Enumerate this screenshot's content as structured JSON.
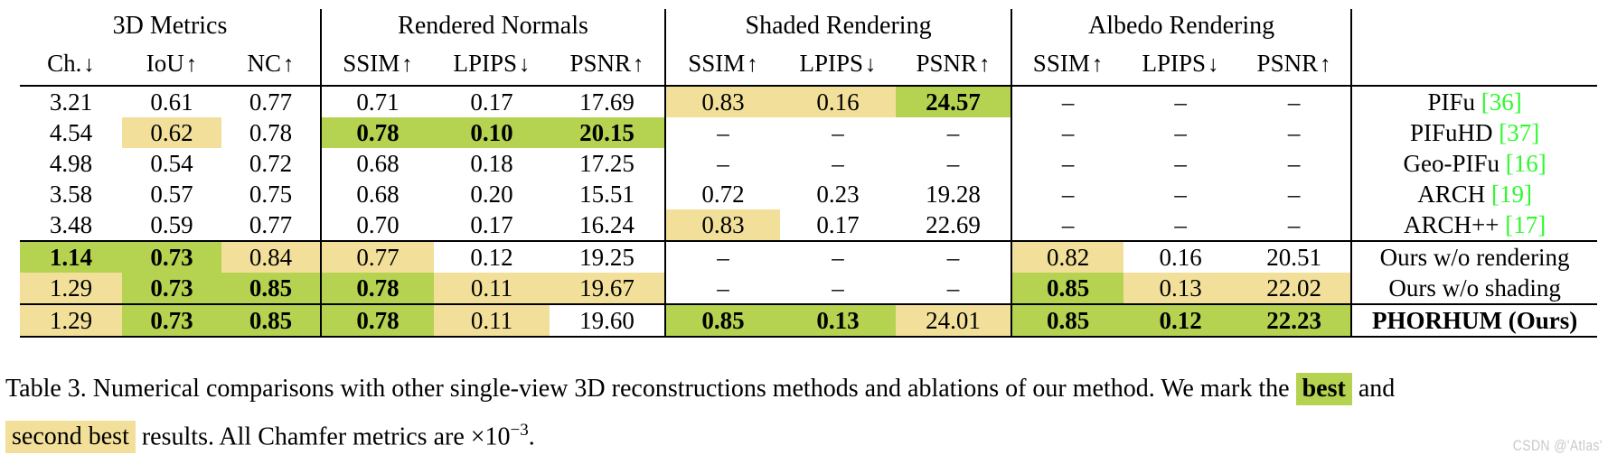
{
  "table": {
    "groups": [
      {
        "label": "3D Metrics",
        "span": 3
      },
      {
        "label": "Rendered Normals",
        "span": 3
      },
      {
        "label": "Shaded Rendering",
        "span": 3
      },
      {
        "label": "Albedo Rendering",
        "span": 3
      },
      {
        "label": "",
        "span": 1
      }
    ],
    "metric_headers": [
      {
        "name": "Ch.",
        "arrow": "↓"
      },
      {
        "name": "IoU",
        "arrow": "↑"
      },
      {
        "name": "NC",
        "arrow": "↑"
      },
      {
        "name": "SSIM",
        "arrow": "↑"
      },
      {
        "name": "LPIPS",
        "arrow": "↓"
      },
      {
        "name": "PSNR",
        "arrow": "↑"
      },
      {
        "name": "SSIM",
        "arrow": "↑"
      },
      {
        "name": "LPIPS",
        "arrow": "↓"
      },
      {
        "name": "PSNR",
        "arrow": "↑"
      },
      {
        "name": "SSIM",
        "arrow": "↑"
      },
      {
        "name": "LPIPS",
        "arrow": "↓"
      },
      {
        "name": "PSNR",
        "arrow": "↑"
      },
      {
        "name": "",
        "arrow": ""
      }
    ],
    "rows": [
      {
        "method": "PIFu",
        "citation": "[36]",
        "method_bold": false,
        "cells": [
          {
            "v": "3.21",
            "hl": "none",
            "bold": false
          },
          {
            "v": "0.61",
            "hl": "none",
            "bold": false
          },
          {
            "v": "0.77",
            "hl": "none",
            "bold": false
          },
          {
            "v": "0.71",
            "hl": "none",
            "bold": false
          },
          {
            "v": "0.17",
            "hl": "none",
            "bold": false
          },
          {
            "v": "17.69",
            "hl": "none",
            "bold": false
          },
          {
            "v": "0.83",
            "hl": "yellow",
            "bold": false
          },
          {
            "v": "0.16",
            "hl": "yellow",
            "bold": false
          },
          {
            "v": "24.57",
            "hl": "green",
            "bold": true
          },
          {
            "v": "–",
            "hl": "none",
            "bold": false
          },
          {
            "v": "–",
            "hl": "none",
            "bold": false
          },
          {
            "v": "–",
            "hl": "none",
            "bold": false
          }
        ]
      },
      {
        "method": "PIFuHD",
        "citation": "[37]",
        "method_bold": false,
        "cells": [
          {
            "v": "4.54",
            "hl": "none",
            "bold": false
          },
          {
            "v": "0.62",
            "hl": "yellow",
            "bold": false
          },
          {
            "v": "0.78",
            "hl": "none",
            "bold": false
          },
          {
            "v": "0.78",
            "hl": "green",
            "bold": true
          },
          {
            "v": "0.10",
            "hl": "green",
            "bold": true
          },
          {
            "v": "20.15",
            "hl": "green",
            "bold": true
          },
          {
            "v": "–",
            "hl": "none",
            "bold": false
          },
          {
            "v": "–",
            "hl": "none",
            "bold": false
          },
          {
            "v": "–",
            "hl": "none",
            "bold": false
          },
          {
            "v": "–",
            "hl": "none",
            "bold": false
          },
          {
            "v": "–",
            "hl": "none",
            "bold": false
          },
          {
            "v": "–",
            "hl": "none",
            "bold": false
          }
        ]
      },
      {
        "method": "Geo-PIFu",
        "citation": "[16]",
        "method_bold": false,
        "cells": [
          {
            "v": "4.98",
            "hl": "none",
            "bold": false
          },
          {
            "v": "0.54",
            "hl": "none",
            "bold": false
          },
          {
            "v": "0.72",
            "hl": "none",
            "bold": false
          },
          {
            "v": "0.68",
            "hl": "none",
            "bold": false
          },
          {
            "v": "0.18",
            "hl": "none",
            "bold": false
          },
          {
            "v": "17.25",
            "hl": "none",
            "bold": false
          },
          {
            "v": "–",
            "hl": "none",
            "bold": false
          },
          {
            "v": "–",
            "hl": "none",
            "bold": false
          },
          {
            "v": "–",
            "hl": "none",
            "bold": false
          },
          {
            "v": "–",
            "hl": "none",
            "bold": false
          },
          {
            "v": "–",
            "hl": "none",
            "bold": false
          },
          {
            "v": "–",
            "hl": "none",
            "bold": false
          }
        ]
      },
      {
        "method": "ARCH",
        "citation": "[19]",
        "method_bold": false,
        "cells": [
          {
            "v": "3.58",
            "hl": "none",
            "bold": false
          },
          {
            "v": "0.57",
            "hl": "none",
            "bold": false
          },
          {
            "v": "0.75",
            "hl": "none",
            "bold": false
          },
          {
            "v": "0.68",
            "hl": "none",
            "bold": false
          },
          {
            "v": "0.20",
            "hl": "none",
            "bold": false
          },
          {
            "v": "15.51",
            "hl": "none",
            "bold": false
          },
          {
            "v": "0.72",
            "hl": "none",
            "bold": false
          },
          {
            "v": "0.23",
            "hl": "none",
            "bold": false
          },
          {
            "v": "19.28",
            "hl": "none",
            "bold": false
          },
          {
            "v": "–",
            "hl": "none",
            "bold": false
          },
          {
            "v": "–",
            "hl": "none",
            "bold": false
          },
          {
            "v": "–",
            "hl": "none",
            "bold": false
          }
        ]
      },
      {
        "method": "ARCH++",
        "citation": "[17]",
        "method_bold": false,
        "cells": [
          {
            "v": "3.48",
            "hl": "none",
            "bold": false
          },
          {
            "v": "0.59",
            "hl": "none",
            "bold": false
          },
          {
            "v": "0.77",
            "hl": "none",
            "bold": false
          },
          {
            "v": "0.70",
            "hl": "none",
            "bold": false
          },
          {
            "v": "0.17",
            "hl": "none",
            "bold": false
          },
          {
            "v": "16.24",
            "hl": "none",
            "bold": false
          },
          {
            "v": "0.83",
            "hl": "yellow",
            "bold": false
          },
          {
            "v": "0.17",
            "hl": "none",
            "bold": false
          },
          {
            "v": "22.69",
            "hl": "none",
            "bold": false
          },
          {
            "v": "–",
            "hl": "none",
            "bold": false
          },
          {
            "v": "–",
            "hl": "none",
            "bold": false
          },
          {
            "v": "–",
            "hl": "none",
            "bold": false
          }
        ]
      },
      {
        "method": "Ours w/o rendering",
        "citation": "",
        "method_bold": false,
        "section_start": true,
        "cells": [
          {
            "v": "1.14",
            "hl": "green",
            "bold": true
          },
          {
            "v": "0.73",
            "hl": "green",
            "bold": true
          },
          {
            "v": "0.84",
            "hl": "yellow",
            "bold": false
          },
          {
            "v": "0.77",
            "hl": "yellow",
            "bold": false
          },
          {
            "v": "0.12",
            "hl": "none",
            "bold": false
          },
          {
            "v": "19.25",
            "hl": "none",
            "bold": false
          },
          {
            "v": "–",
            "hl": "none",
            "bold": false
          },
          {
            "v": "–",
            "hl": "none",
            "bold": false
          },
          {
            "v": "–",
            "hl": "none",
            "bold": false
          },
          {
            "v": "0.82",
            "hl": "yellow",
            "bold": false
          },
          {
            "v": "0.16",
            "hl": "none",
            "bold": false
          },
          {
            "v": "20.51",
            "hl": "none",
            "bold": false
          }
        ]
      },
      {
        "method": "Ours w/o shading",
        "citation": "",
        "method_bold": false,
        "cells": [
          {
            "v": "1.29",
            "hl": "yellow",
            "bold": false
          },
          {
            "v": "0.73",
            "hl": "green",
            "bold": true
          },
          {
            "v": "0.85",
            "hl": "green",
            "bold": true
          },
          {
            "v": "0.78",
            "hl": "green",
            "bold": true
          },
          {
            "v": "0.11",
            "hl": "yellow",
            "bold": false
          },
          {
            "v": "19.67",
            "hl": "yellow",
            "bold": false
          },
          {
            "v": "–",
            "hl": "none",
            "bold": false
          },
          {
            "v": "–",
            "hl": "none",
            "bold": false
          },
          {
            "v": "–",
            "hl": "none",
            "bold": false
          },
          {
            "v": "0.85",
            "hl": "green",
            "bold": true
          },
          {
            "v": "0.13",
            "hl": "yellow",
            "bold": false
          },
          {
            "v": "22.02",
            "hl": "yellow",
            "bold": false
          }
        ]
      },
      {
        "method": "PHORHUM (Ours)",
        "citation": "",
        "method_bold": true,
        "section_start": true,
        "cells": [
          {
            "v": "1.29",
            "hl": "yellow",
            "bold": false
          },
          {
            "v": "0.73",
            "hl": "green",
            "bold": true
          },
          {
            "v": "0.85",
            "hl": "green",
            "bold": true
          },
          {
            "v": "0.78",
            "hl": "green",
            "bold": true
          },
          {
            "v": "0.11",
            "hl": "yellow",
            "bold": false
          },
          {
            "v": "19.60",
            "hl": "none",
            "bold": false
          },
          {
            "v": "0.85",
            "hl": "green",
            "bold": true
          },
          {
            "v": "0.13",
            "hl": "green",
            "bold": true
          },
          {
            "v": "24.01",
            "hl": "yellow",
            "bold": false
          },
          {
            "v": "0.85",
            "hl": "green",
            "bold": true
          },
          {
            "v": "0.12",
            "hl": "green",
            "bold": true
          },
          {
            "v": "22.23",
            "hl": "green",
            "bold": true
          }
        ]
      }
    ]
  },
  "caption": {
    "line1_a": "Table 3. Numerical comparisons with other single-view 3D reconstructions methods and ablations of our method. We mark the",
    "best_label": "best",
    "line1_b": "and",
    "second_label": "second best",
    "line2_b": "results. All Chamfer metrics are ×10",
    "exponent": "−3",
    "line2_c": "."
  },
  "watermark": "CSDN @'Atlas'",
  "colors": {
    "best_green": "#b5d350",
    "second_yellow": "#f2e09a",
    "citation_green": "#2dfa2d",
    "rule": "#000000",
    "watermark": "#c9c9c9"
  }
}
